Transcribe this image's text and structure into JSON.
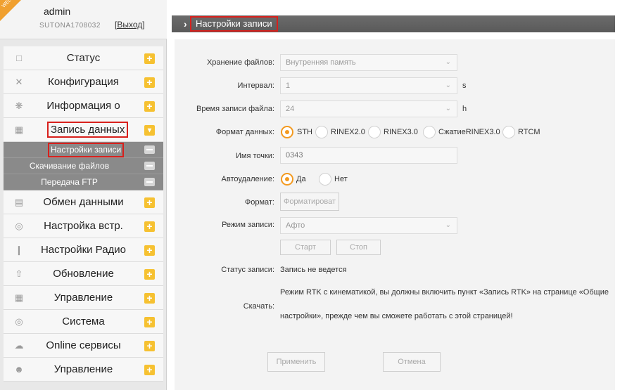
{
  "user": {
    "welcome_badge": "WELCOME",
    "name": "admin",
    "serial": "SUTONA1708032",
    "logout": "[Выход]"
  },
  "nav": {
    "items": [
      {
        "label": "Статус",
        "icon": "monitor-icon"
      },
      {
        "label": "Конфигурация",
        "icon": "tools-icon"
      },
      {
        "label": "Информация о",
        "icon": "satellite-icon"
      },
      {
        "label": "Запись данных",
        "icon": "calendar-icon"
      },
      {
        "label": "Обмен данными",
        "icon": "computer-icon"
      },
      {
        "label": "Настройка встр.",
        "icon": "globe-icon"
      },
      {
        "label": "Настройки Радио",
        "icon": "antenna-icon"
      },
      {
        "label": "Обновление",
        "icon": "upload-icon"
      },
      {
        "label": "Управление",
        "icon": "calendar-icon"
      },
      {
        "label": "Система",
        "icon": "globe-icon"
      },
      {
        "label": "Online сервисы",
        "icon": "cloud-icon"
      },
      {
        "label": "Управление",
        "icon": "user-icon"
      }
    ],
    "sub_items": [
      {
        "label": "Настройки записи"
      },
      {
        "label": "Скачивание файлов"
      },
      {
        "label": "Передача FTP"
      }
    ]
  },
  "header": {
    "title": "Настройки записи"
  },
  "form": {
    "storage_label": "Хранение файлов:",
    "storage_value": "Внутренняя память",
    "interval_label": "Интервал:",
    "interval_value": "1",
    "interval_unit": "s",
    "duration_label": "Время записи файла:",
    "duration_value": "24",
    "duration_unit": "h",
    "format_label": "Формат данных:",
    "format_options": [
      "STH",
      "RINEX2.0",
      "RINEX3.0",
      "СжатиеRINEX3.0",
      "RTCM"
    ],
    "format_selected": "STH",
    "point_label": "Имя точки:",
    "point_value": "0343",
    "autodelete_label": "Автоудаление:",
    "autodelete_options": [
      "Да",
      "Нет"
    ],
    "autodelete_selected": "Да",
    "format_disk_label": "Формат:",
    "format_disk_button": "Форматироват",
    "mode_label": "Режим записи:",
    "mode_value": "Афто",
    "start_button": "Старт",
    "stop_button": "Стоп",
    "status_label": "Статус записи:",
    "status_value": "Запись не ведется",
    "download_label": "Скачать:",
    "download_note_line1": "Режим RTK с кинематикой, вы должны включить пункт «Запись RTK» на странице «Общие",
    "download_note_line2": "настройки», прежде чем вы сможете работать с этой страницей!",
    "apply_button": "Применить",
    "cancel_button": "Отмена"
  },
  "colors": {
    "accent_orange": "#f39a20",
    "plus_yellow": "#f6c131",
    "highlight_red": "#d8201c",
    "header_gray": "#5f5f5f"
  }
}
